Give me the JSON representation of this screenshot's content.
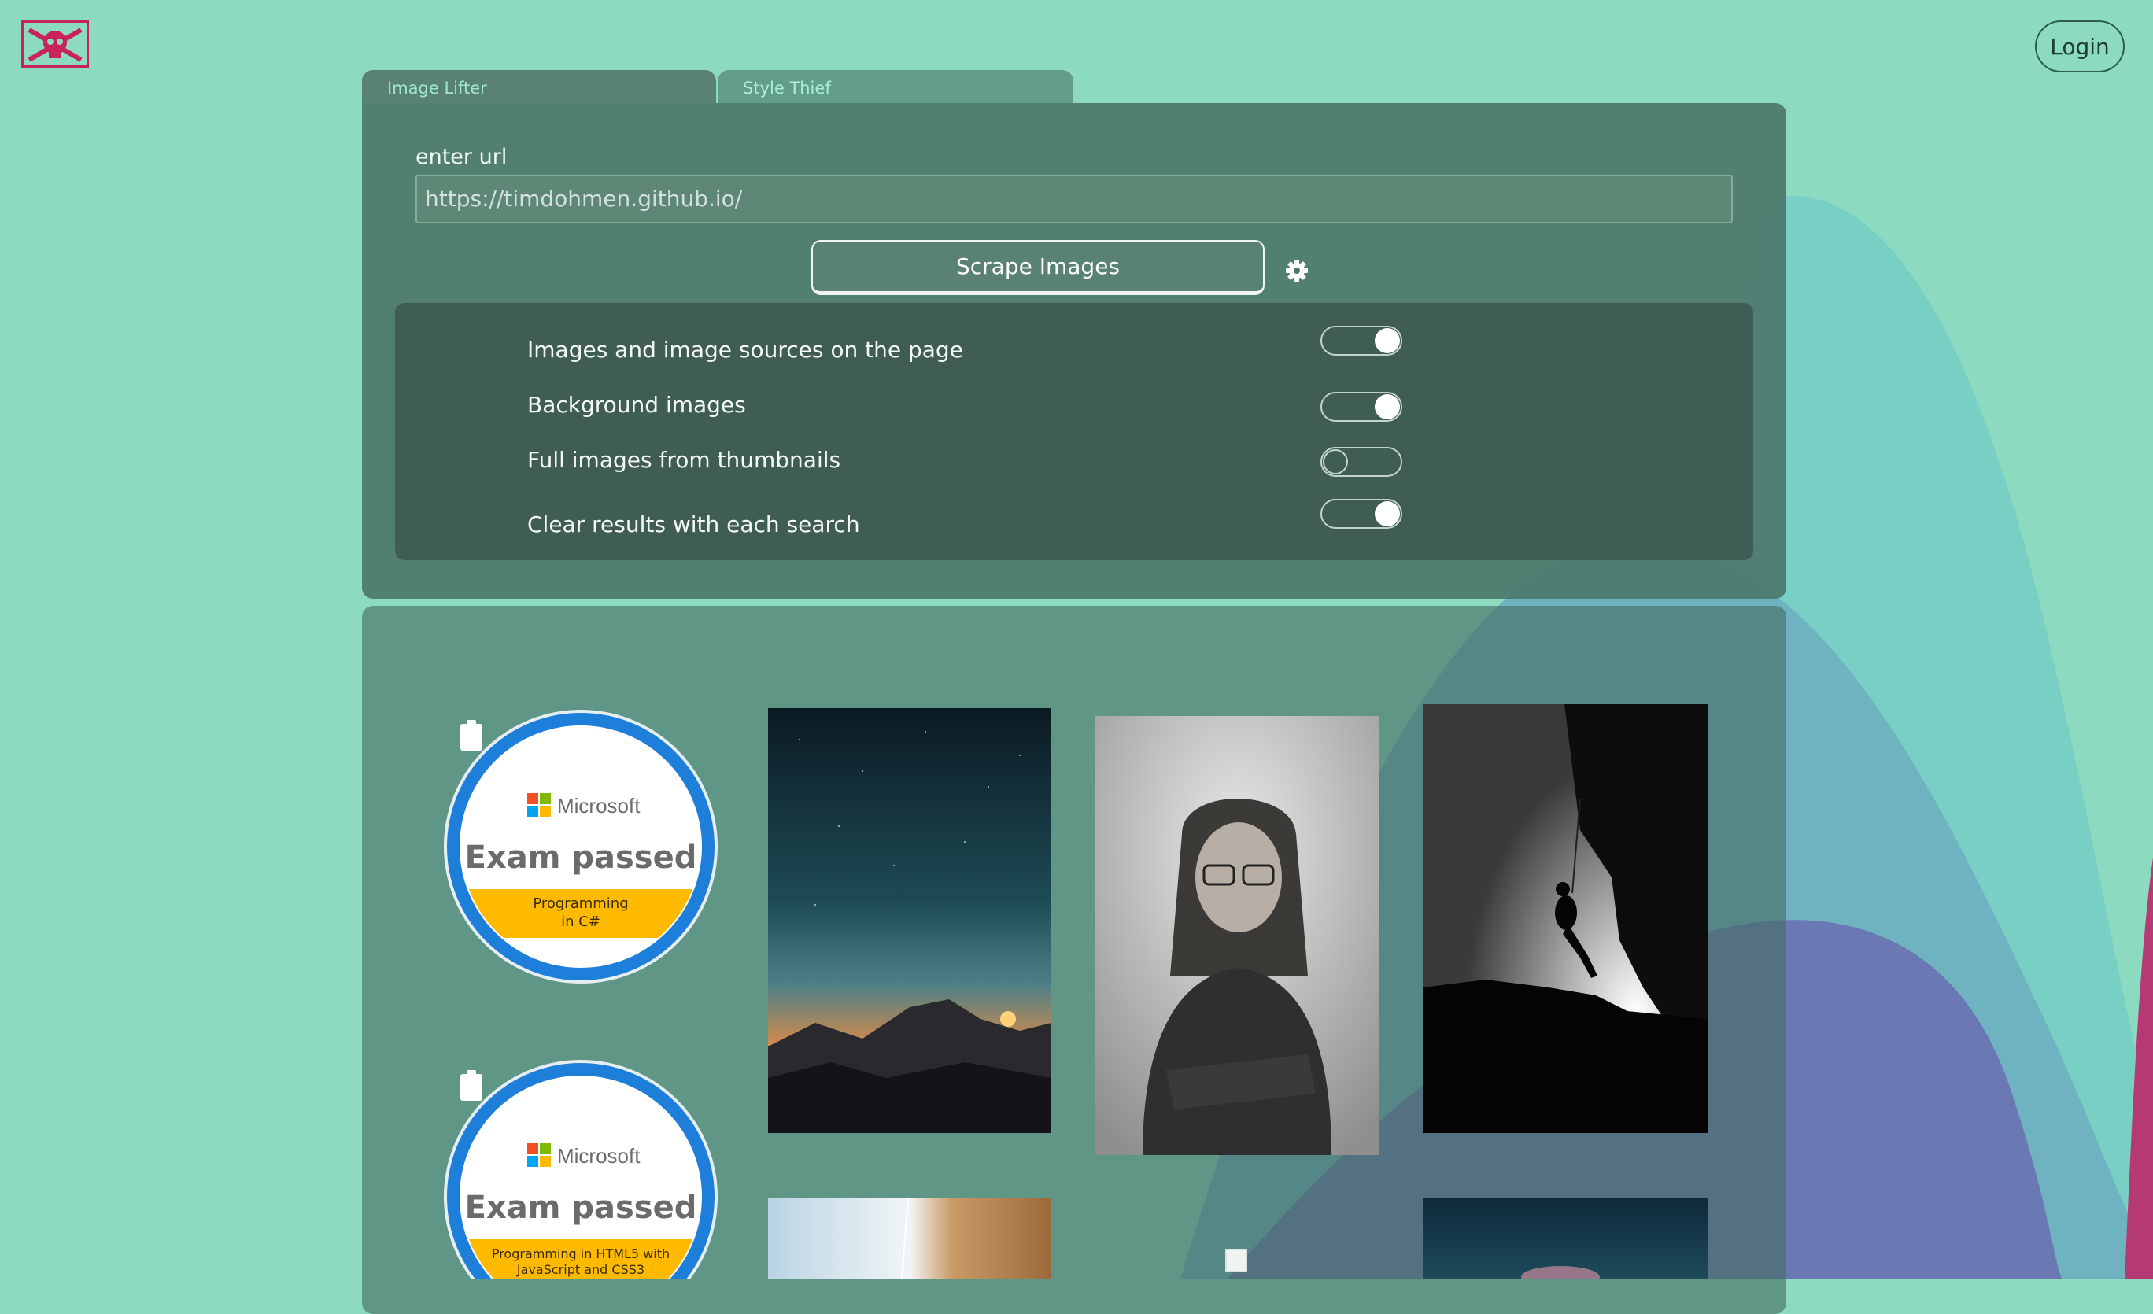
{
  "app": {
    "logo_icon": "skull-crossbones-icon"
  },
  "header": {
    "login_label": "Login"
  },
  "tabs": [
    {
      "label": "Image Lifter",
      "active": true
    },
    {
      "label": "Style Thief",
      "active": false
    }
  ],
  "form": {
    "url_label": "enter url",
    "url_value": "https://timdohmen.github.io/",
    "scrape_label": "Scrape Images",
    "settings_icon": "gear-icon"
  },
  "options": [
    {
      "label": "Images and image sources on the page",
      "enabled": true
    },
    {
      "label": "Background images",
      "enabled": true
    },
    {
      "label": "Full images from thumbnails",
      "enabled": false
    },
    {
      "label": "Clear results with each search",
      "enabled": true
    }
  ],
  "badges": [
    {
      "brand": "Microsoft",
      "title": "Exam passed",
      "line1": "Programming",
      "line2": "in C#"
    },
    {
      "brand": "Microsoft",
      "title": "Exam passed",
      "line1": "Programming in HTML5 with",
      "line2": "JavaScript and CSS3"
    }
  ],
  "colors": {
    "background": "#8cdbc1",
    "panel": "#4c786b",
    "options_panel": "#3f5d54",
    "badge_blue": "#1d7fd9",
    "badge_yellow": "#ffb900"
  }
}
